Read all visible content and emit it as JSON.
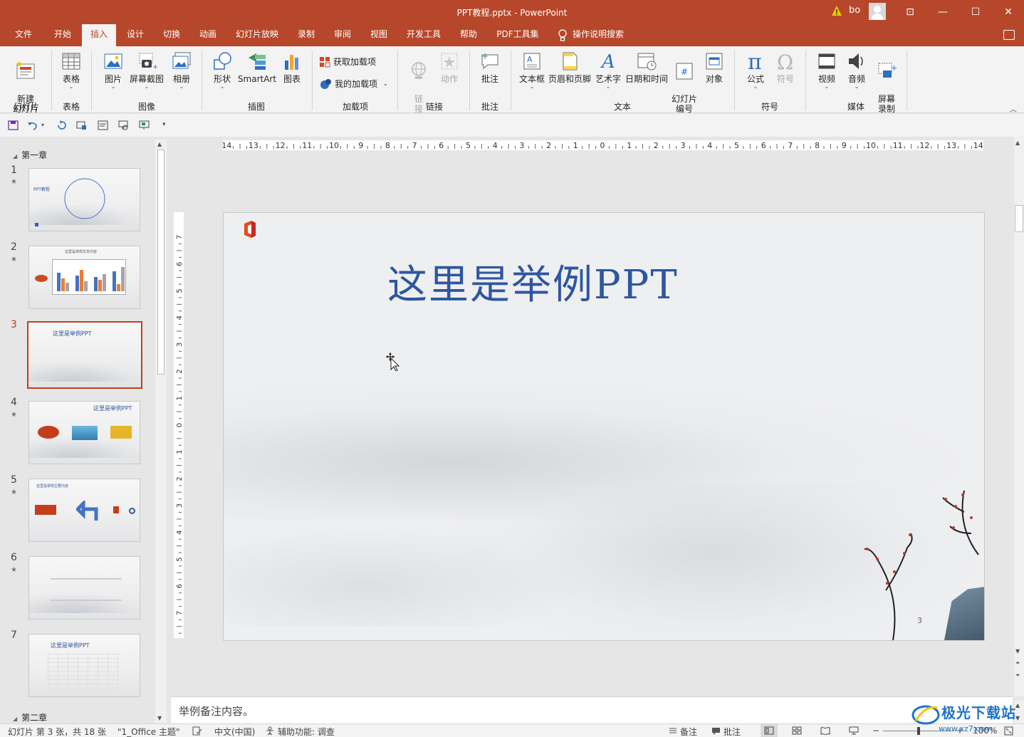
{
  "window": {
    "title": "PPT教程.pptx  -  PowerPoint",
    "user": "bo",
    "min_label": "—",
    "max_label": "☐",
    "close_label": "✕",
    "ribbon_display_label": "⊡"
  },
  "tabs": [
    "文件",
    "开始",
    "插入",
    "设计",
    "切换",
    "动画",
    "幻灯片放映",
    "录制",
    "审阅",
    "视图",
    "开发工具",
    "帮助",
    "PDF工具集"
  ],
  "active_tab": "插入",
  "tell_me": "操作说明搜索",
  "ribbon": {
    "new_slide": "新建\n幻灯片",
    "table": "表格",
    "picture": "图片",
    "screenshot": "屏幕截图",
    "album": "相册",
    "shapes": "形状",
    "smartart": "SmartArt",
    "chart": "图表",
    "get_addins": "获取加载项",
    "my_addins": "我的加载项",
    "link": "链\n接",
    "action": "动作",
    "comment": "批注",
    "textbox": "文本框",
    "header_footer": "页眉和页脚",
    "wordart": "艺术字",
    "datetime": "日期和时间",
    "slide_number": "幻灯片\n编号",
    "object": "对象",
    "equation": "公式",
    "symbol": "符号",
    "video": "视频",
    "audio": "音频",
    "screen_recording": "屏幕\n录制",
    "groups": {
      "slides": "幻灯片",
      "tables": "表格",
      "images": "图像",
      "illustrations": "插图",
      "addins": "加载项",
      "links": "链接",
      "comments": "批注",
      "text": "文本",
      "symbols": "符号",
      "media": "媒体"
    }
  },
  "thumbnails": {
    "section1": "第一章",
    "section2": "第二章",
    "slides": [
      {
        "num": "1",
        "title": "PPT教程"
      },
      {
        "num": "2",
        "title": "这里是举例文本内容"
      },
      {
        "num": "3",
        "title": "这里是举例PPT"
      },
      {
        "num": "4",
        "title": "这里是举例PPT"
      },
      {
        "num": "5",
        "title": "这里是举例主要内容"
      },
      {
        "num": "6",
        "title": ""
      },
      {
        "num": "7",
        "title": "这里是举例PPT"
      }
    ],
    "selected": "3"
  },
  "slide": {
    "headline": "这里是举例PPT",
    "page_number": "3"
  },
  "notes": "举例备注内容。",
  "status": {
    "slide_info": "幻灯片 第 3 张，共 18 张",
    "theme": "\"1_Office 主题\"",
    "language": "中文(中国)",
    "accessibility": "辅助功能: 调查",
    "notes_btn": "备注",
    "comments_btn": "批注",
    "zoom": "100%"
  },
  "watermark": {
    "brand": "极光下载站",
    "url": "www.xz7.com"
  },
  "colors": {
    "accent": "#b7472a",
    "title_blue": "#2e56a0",
    "selection": "#c43e1c"
  }
}
